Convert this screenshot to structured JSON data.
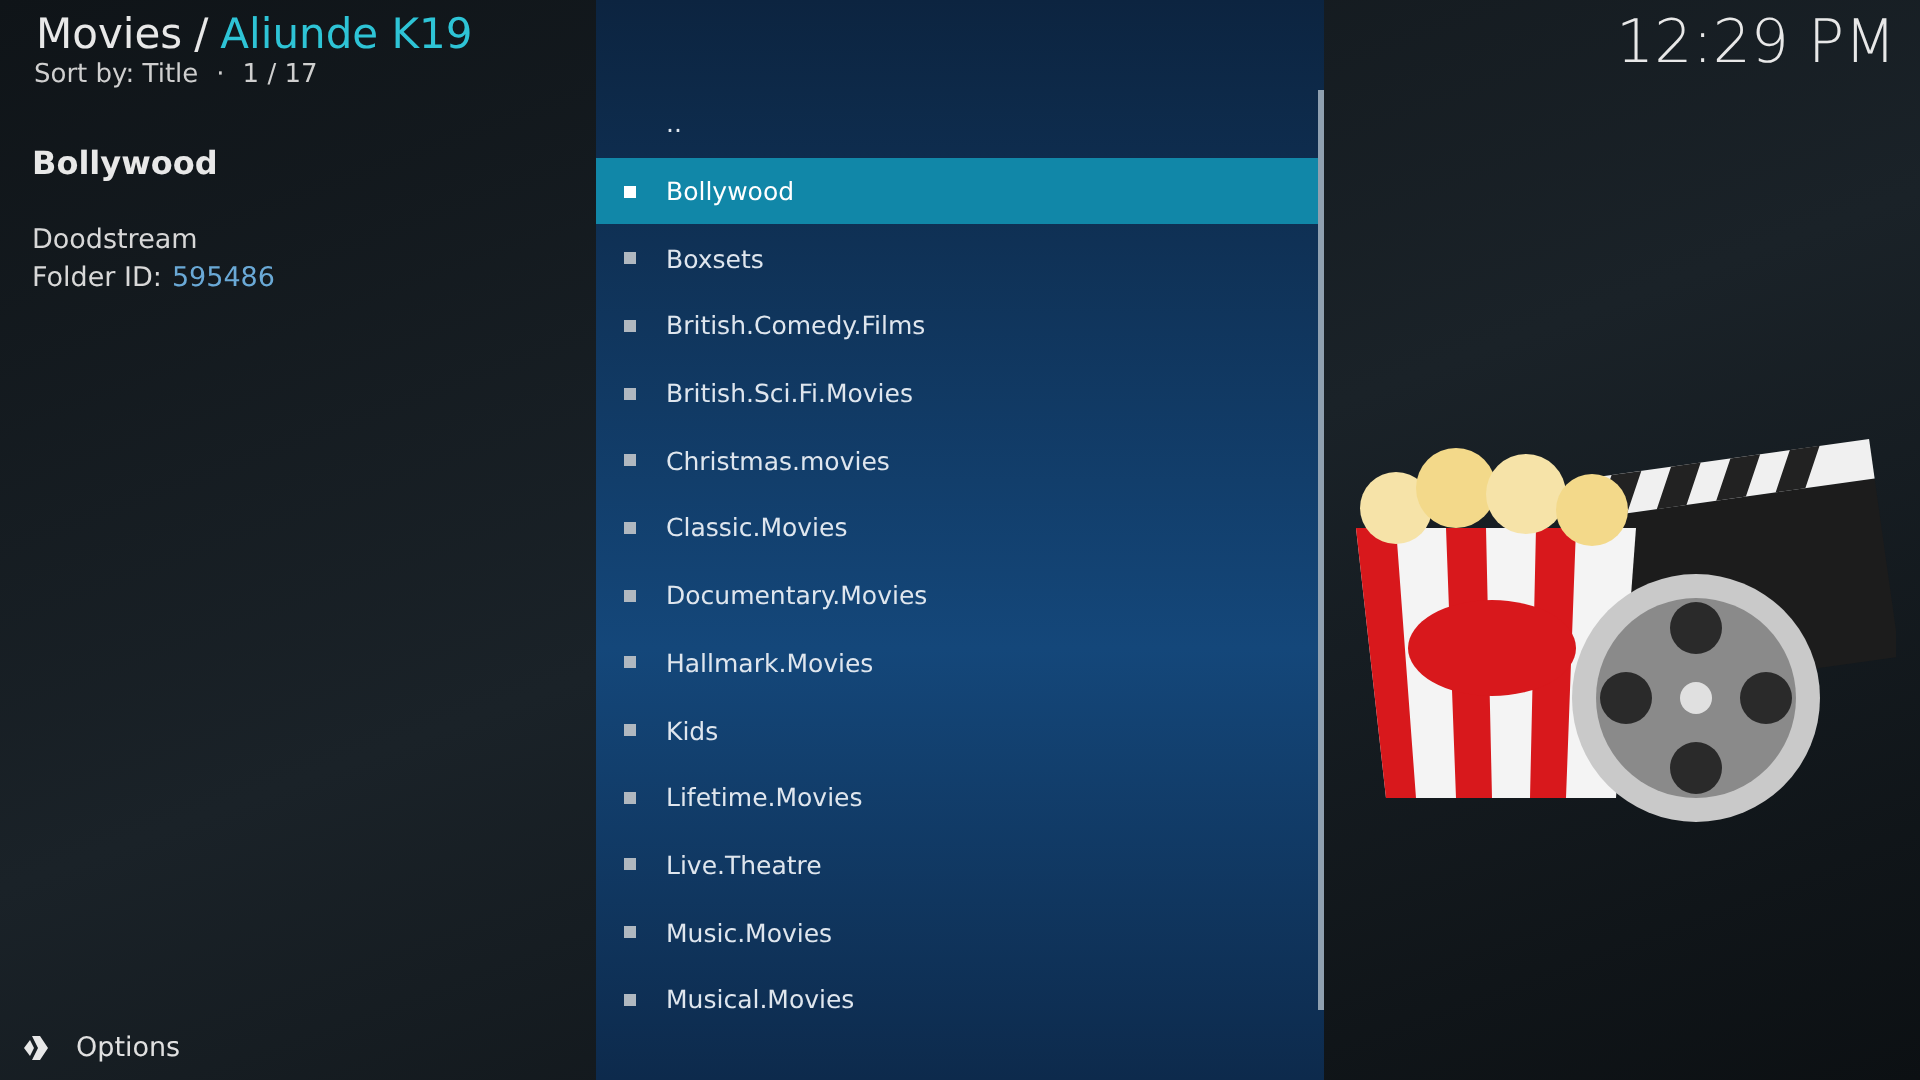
{
  "header": {
    "section": "Movies",
    "separator": "/",
    "addon": "Aliunde K19",
    "sort": "Sort by: Title",
    "dot": "·",
    "position": "1 / 17"
  },
  "clock": "12:29 PM",
  "info": {
    "title": "Bollywood",
    "source": "Doodstream",
    "folder_label": "Folder ID:",
    "folder_id": "595486"
  },
  "list": [
    {
      "label": "..",
      "kind": "parent",
      "selected": false
    },
    {
      "label": "Bollywood",
      "kind": "folder",
      "selected": true
    },
    {
      "label": "Boxsets",
      "kind": "folder",
      "selected": false
    },
    {
      "label": "British.Comedy.Films",
      "kind": "folder",
      "selected": false
    },
    {
      "label": "British.Sci.Fi.Movies",
      "kind": "folder",
      "selected": false
    },
    {
      "label": "Christmas.movies",
      "kind": "folder",
      "selected": false
    },
    {
      "label": "Classic.Movies",
      "kind": "folder",
      "selected": false
    },
    {
      "label": "Documentary.Movies",
      "kind": "folder",
      "selected": false
    },
    {
      "label": "Hallmark.Movies",
      "kind": "folder",
      "selected": false
    },
    {
      "label": "Kids",
      "kind": "folder",
      "selected": false
    },
    {
      "label": "Lifetime.Movies",
      "kind": "folder",
      "selected": false
    },
    {
      "label": "Live.Theatre",
      "kind": "folder",
      "selected": false
    },
    {
      "label": "Music.Movies",
      "kind": "folder",
      "selected": false
    },
    {
      "label": "Musical.Movies",
      "kind": "folder",
      "selected": false
    }
  ],
  "options": "Options"
}
